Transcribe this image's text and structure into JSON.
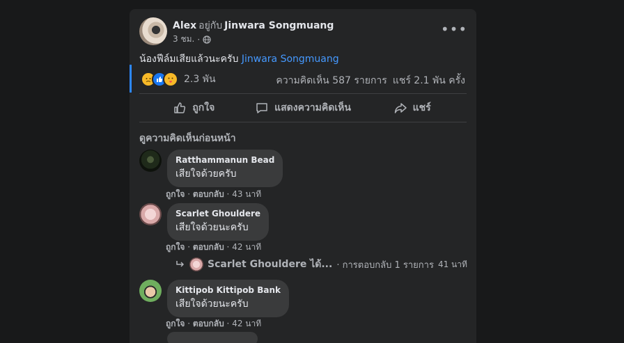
{
  "post": {
    "author": "Alex",
    "with_text": "อยู่กับ",
    "tagged": "Jinwara Songmuang",
    "time": "3 ชม.",
    "separator": "·",
    "text": "น้องฟีล์มเสียแล้วนะครับ",
    "mention": "Jinwara Songmuang",
    "reaction_count": "2.3 พัน",
    "comments_stat": "ความคิดเห็น 587 รายการ",
    "shares_stat": "แชร์ 2.1 พัน ครั้ง",
    "more_glyph": "•••"
  },
  "actions": {
    "like": "ถูกใจ",
    "comment": "แสดงความคิดเห็น",
    "share": "แชร์"
  },
  "prev_comments_label": "ดูความคิดเห็นก่อนหน้า",
  "comments": [
    {
      "name": "Ratthammanun Bead",
      "text": "เสียใจด้วยครับ",
      "like": "ถูกใจ",
      "reply": "ตอบกลับ",
      "time": "43 นาที"
    },
    {
      "name": "Scarlet Ghouldere",
      "text": "เสียใจด้วยนะครับ",
      "like": "ถูกใจ",
      "reply": "ตอบกลับ",
      "time": "42 นาที"
    },
    {
      "name": "Kittipob Kittipob Bank",
      "text": "เสียใจด้วยนะครับ",
      "like": "ถูกใจ",
      "reply": "ตอบกลับ",
      "time": "42 นาที"
    }
  ],
  "reply_summary": {
    "text": "Scarlet Ghouldere ได้...",
    "count": "· การตอบกลับ 1 รายการ",
    "time": "41 นาที"
  },
  "colors": {
    "background": "#18191a",
    "card": "#242526",
    "bubble": "#3a3b3c",
    "link": "#4599ff",
    "accent": "#2d88ff"
  },
  "icons": [
    "globe-icon",
    "more-icon",
    "sad-reaction-icon",
    "like-reaction-icon",
    "care-reaction-icon",
    "like-icon",
    "comment-icon",
    "share-icon",
    "reply-arrow-icon"
  ]
}
